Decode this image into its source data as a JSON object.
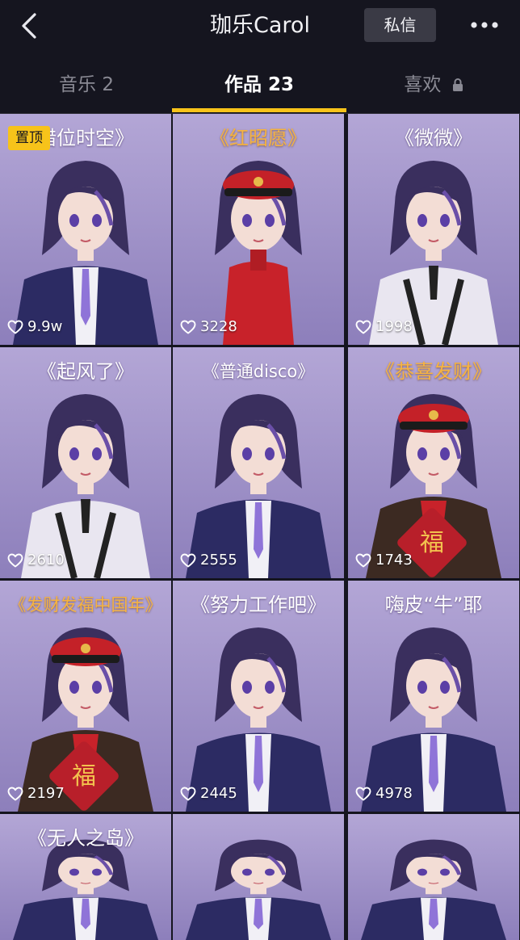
{
  "header": {
    "title": "珈乐Carol",
    "dm_label": "私信"
  },
  "tabs": [
    {
      "label": "音乐 2",
      "active": false
    },
    {
      "label": "作品 23",
      "active": true
    },
    {
      "label": "喜欢",
      "active": false,
      "locked": true
    }
  ],
  "pin_label": "置顶",
  "works": [
    {
      "caption": "错位时空》",
      "likes": "9.9w",
      "style": "white",
      "outfit": "jacket"
    },
    {
      "caption": "《红昭愿》",
      "likes": "3228",
      "style": "gold",
      "outfit": "qipao"
    },
    {
      "caption": "《微微》",
      "likes": "1998",
      "style": "white",
      "outfit": "white"
    },
    {
      "caption": "《起风了》",
      "likes": "2610",
      "style": "white",
      "outfit": "white"
    },
    {
      "caption": "《普通disco》",
      "likes": "2555",
      "style": "white",
      "outfit": "jacket"
    },
    {
      "caption": "《恭喜发财》",
      "likes": "1743",
      "style": "gold",
      "outfit": "festive"
    },
    {
      "caption": "《发财发福中国年》",
      "likes": "2197",
      "style": "gold",
      "outfit": "festive"
    },
    {
      "caption": "《努力工作吧》",
      "likes": "2445",
      "style": "white",
      "outfit": "jacket"
    },
    {
      "caption": "嗨皮“牛”耶",
      "likes": "4978",
      "style": "white",
      "outfit": "jacket"
    },
    {
      "caption": "《无人之岛》",
      "likes": "",
      "style": "white",
      "outfit": "jacket"
    },
    {
      "caption": "",
      "likes": "",
      "style": "white",
      "outfit": "jacket"
    },
    {
      "caption": "",
      "likes": "",
      "style": "white",
      "outfit": "jacket"
    }
  ],
  "colors": {
    "accent": "#f7c31a",
    "background": "#15151f",
    "tile_bg_top": "#b3a6d6",
    "tile_bg_bottom": "#8d7fbb",
    "gold_caption": "#f5b342"
  }
}
